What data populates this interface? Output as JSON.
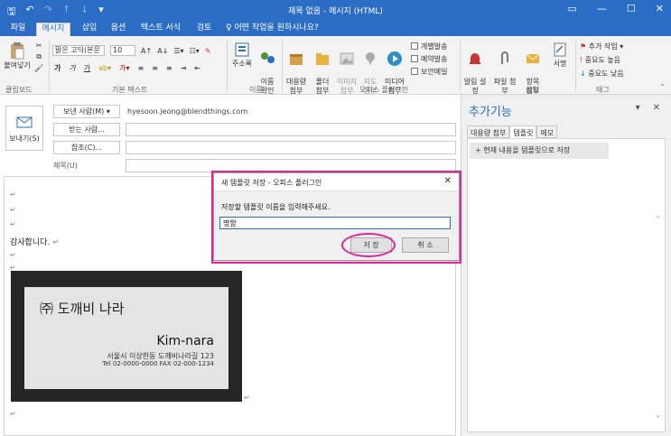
{
  "titlebar": {
    "window_title": "제목 없음 - 메시지 (HTML)"
  },
  "tabs": [
    {
      "label": "파일",
      "active": false
    },
    {
      "label": "메시지",
      "active": true
    },
    {
      "label": "삽입",
      "active": false
    },
    {
      "label": "옵션",
      "active": false
    },
    {
      "label": "텍스트 서식",
      "active": false
    },
    {
      "label": "검토",
      "active": false
    }
  ],
  "tell_me": "♀ 어떤 작업을 원하시나요?",
  "ribbon": {
    "paste_label": "붙여넣기",
    "clipboard_group": "클립보드",
    "font_name": "맑은 고딕(본문",
    "font_size": "10",
    "basic_text_group": "기본 텍스트",
    "address_book": "주소록",
    "check_names": "이름\n확인",
    "names_group": "이름",
    "large_attach": "대용량\n첨부",
    "folder": "폴더\n첨부",
    "image": "이미지\n첨부",
    "map": "지도\n첨부",
    "media": "미디어\n첨부",
    "checkboxes": [
      "개별발송",
      "예약발송",
      "보안메일"
    ],
    "office_plugin_group": "오피스 플러그인",
    "notify": "알림 설\n정",
    "attach_file": "파일 첨\n부",
    "attach_item": "항목\n첨부",
    "signature": "서명",
    "insert_group": "삽입",
    "follow_up": "추가 작업",
    "high_importance": "중요도 높음",
    "low_importance": "중요도 낮음",
    "tags_group": "태그"
  },
  "compose": {
    "send_label": "보내기(S)",
    "from_label": "보낸 사람(M) ▾",
    "from_address": "hyesoon.jeong@blendthings.com",
    "to_label": "받는 사람...",
    "cc_label": "참조(C)...",
    "subject_label": "제목(U)",
    "body_thanks": "감사합니다.",
    "para_mark": "↵"
  },
  "card": {
    "title": "㈜ 도깨비 나라",
    "name": "Kim-nara",
    "address": "서울시 이상한동 도깨비나라길 123",
    "tel": "Tel 02-0000-0000 FAX 02-000-1234"
  },
  "addin": {
    "title": "추가기능",
    "tabs": [
      {
        "label": "대용량 첨부",
        "active": false
      },
      {
        "label": "템플릿",
        "active": true
      },
      {
        "label": "메모",
        "active": false
      }
    ],
    "save_template": "+ 현재 내용을 템플릿으로 저장"
  },
  "dialog": {
    "title": "새 템플릿 저장 - 오피스 플러그인",
    "prompt": "저장할 템플릿 이름을 입력해주세요.",
    "input_value": "명함",
    "save_button": "저 장",
    "cancel_button": "취 소",
    "close": "✕"
  },
  "colors": {
    "brand": "#2b6cc4",
    "highlight": "#e0269a"
  }
}
